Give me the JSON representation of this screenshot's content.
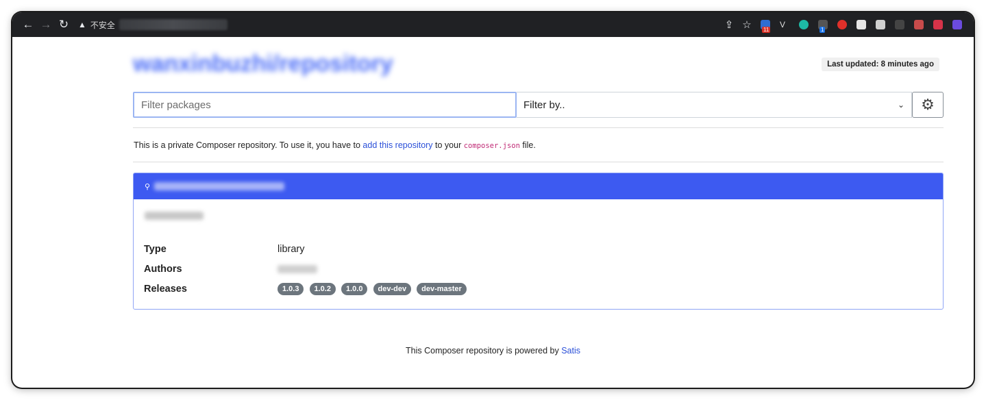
{
  "browser": {
    "insecure_label": "不安全",
    "ext_badge_1": "11",
    "ext_badge_2": "1"
  },
  "header": {
    "repo_title": "wanxinbuzhi/repository",
    "last_updated": "Last updated: 8 minutes ago"
  },
  "filters": {
    "search_placeholder": "Filter packages",
    "filter_by_label": "Filter by.."
  },
  "info": {
    "prefix": "This is a private Composer repository. To use it, you have to ",
    "link_text": "add this repository",
    "middle": " to your ",
    "code": "composer.json",
    "suffix": " file."
  },
  "package": {
    "type_label": "Type",
    "type_value": "library",
    "authors_label": "Authors",
    "releases_label": "Releases",
    "releases": [
      "1.0.3",
      "1.0.2",
      "1.0.0",
      "dev-dev",
      "dev-master"
    ]
  },
  "footer": {
    "text": "This Composer repository is powered by ",
    "link": "Satis"
  },
  "colors": {
    "accent": "#3d5af1",
    "link": "#2a4fd8",
    "badge": "#6c757d"
  }
}
